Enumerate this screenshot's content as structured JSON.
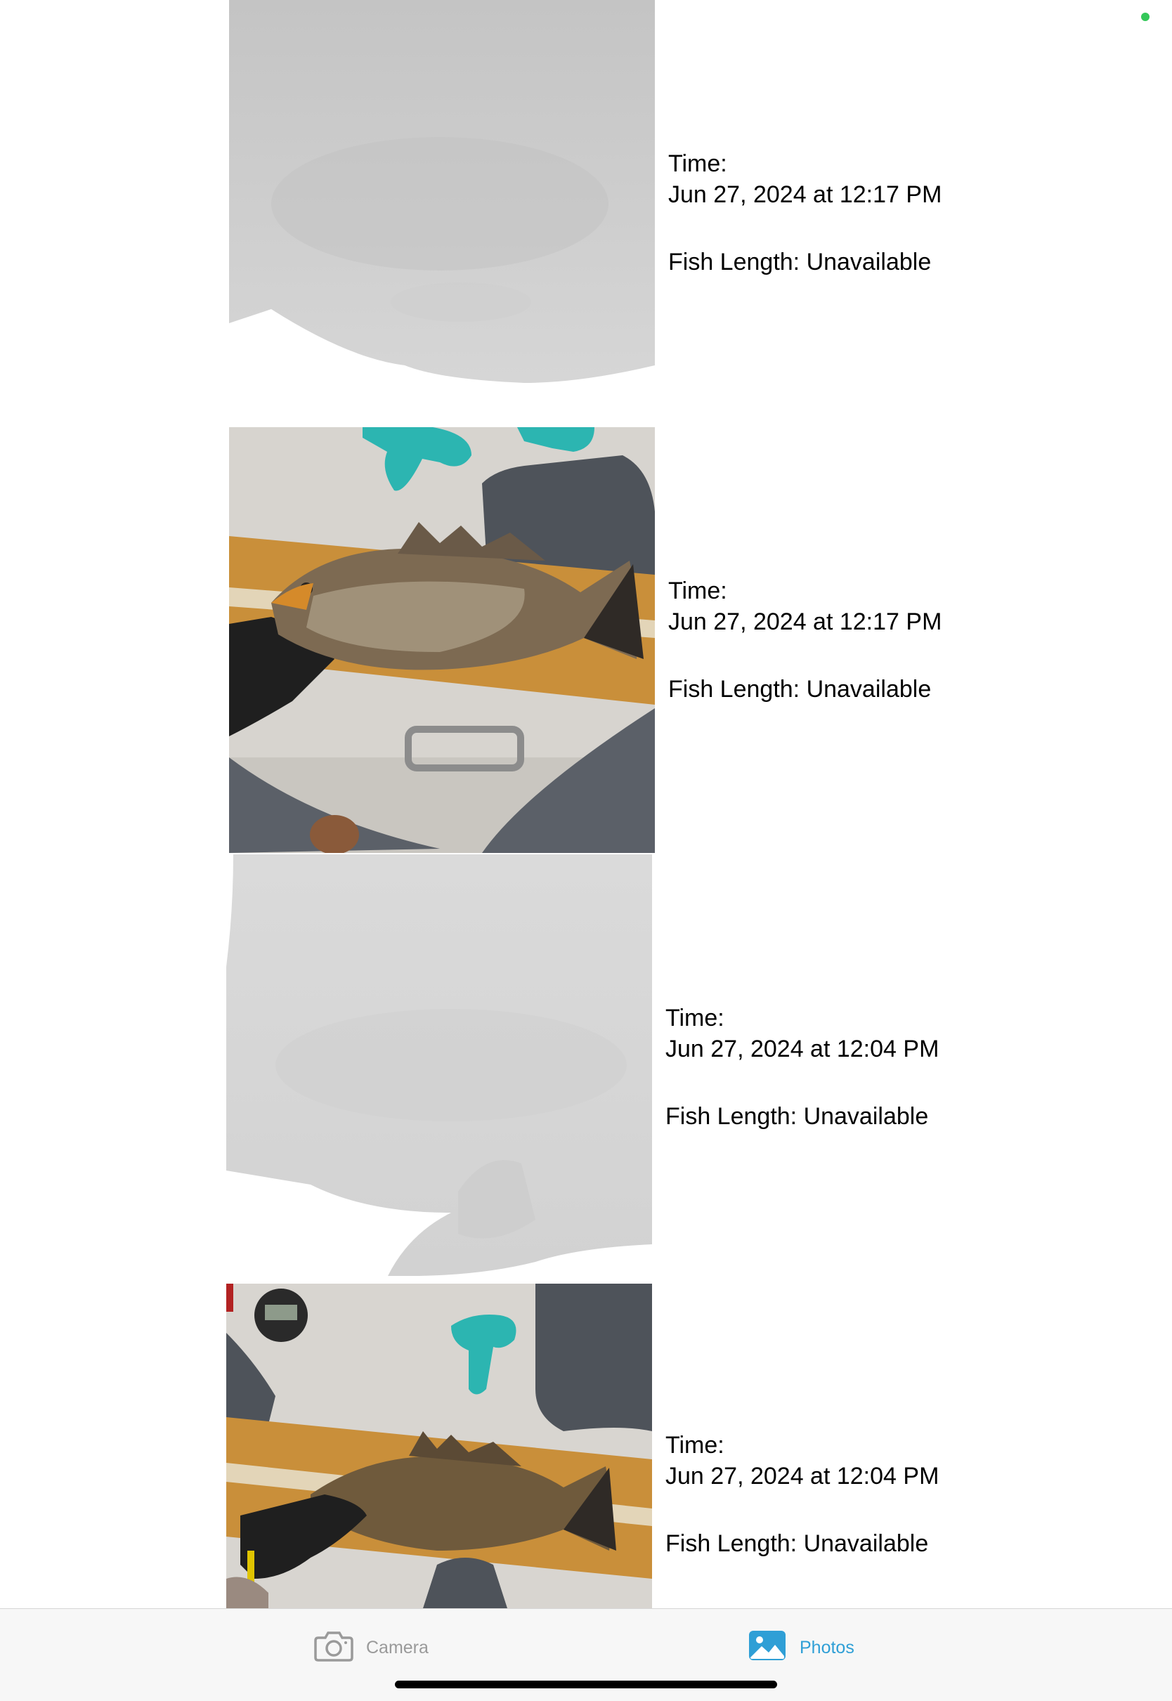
{
  "entries": [
    {
      "time_label": "Time:",
      "timestamp": "Jun 27, 2024 at 12:17 PM",
      "length_label": "Fish Length: Unavailable",
      "image": "depth-map-placeholder"
    },
    {
      "time_label": "Time:",
      "timestamp": "Jun 27, 2024 at 12:17 PM",
      "length_label": "Fish Length: Unavailable",
      "image": "fish-on-measuring-board-photo"
    },
    {
      "time_label": "Time:",
      "timestamp": "Jun 27, 2024 at 12:04 PM",
      "length_label": "Fish Length: Unavailable",
      "image": "depth-map-placeholder"
    },
    {
      "time_label": "Time:",
      "timestamp": "Jun 27, 2024 at 12:04 PM",
      "length_label": "Fish Length: Unavailable",
      "image": "fish-on-measuring-board-photo"
    }
  ],
  "tabbar": {
    "camera": {
      "label": "Camera",
      "icon": "camera-icon",
      "active": false
    },
    "photos": {
      "label": "Photos",
      "icon": "photos-icon",
      "active": true
    }
  },
  "colors": {
    "accent": "#2f9fd6",
    "inactive": "#9a9a9a",
    "status_dot": "#34c759"
  }
}
